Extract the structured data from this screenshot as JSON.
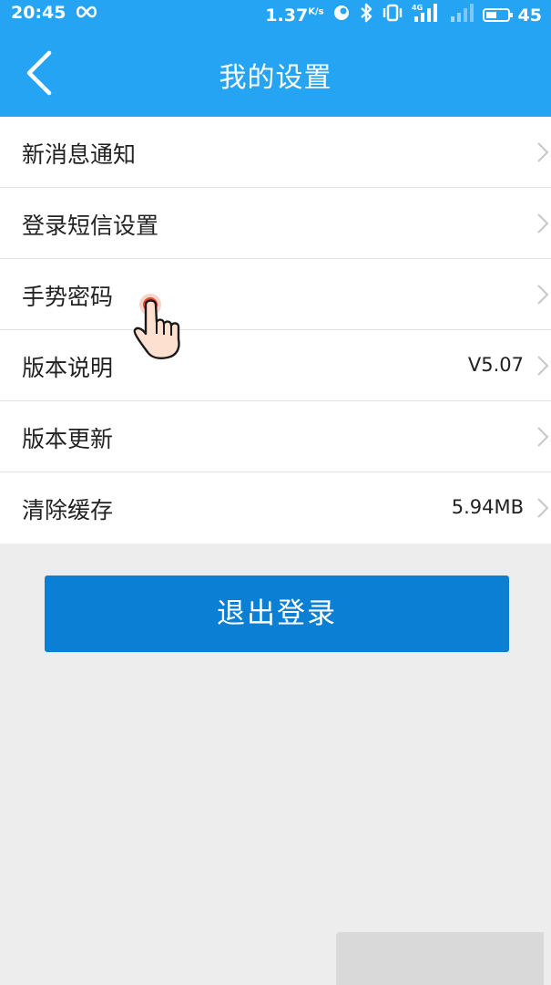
{
  "status_bar": {
    "time": "20:45",
    "speed": "1.37",
    "speed_unit": "K/s",
    "battery": "45"
  },
  "header": {
    "title": "我的设置"
  },
  "settings": [
    {
      "label": "新消息通知",
      "value": ""
    },
    {
      "label": "登录短信设置",
      "value": ""
    },
    {
      "label": "手势密码",
      "value": ""
    },
    {
      "label": "版本说明",
      "value": "V5.07"
    },
    {
      "label": "版本更新",
      "value": ""
    },
    {
      "label": "清除缓存",
      "value": "5.94MB"
    }
  ],
  "logout_label": "退出登录",
  "colors": {
    "header": "#25a4f4",
    "logout": "#0b7fd4",
    "background": "#ededed"
  }
}
